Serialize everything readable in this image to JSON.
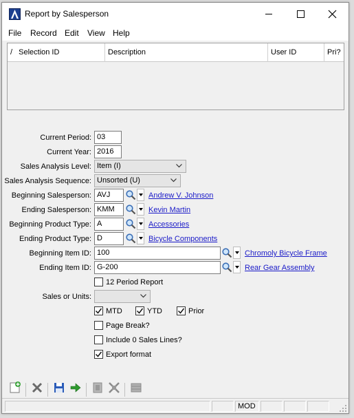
{
  "window": {
    "title": "Report by Salesperson"
  },
  "menu": [
    "File",
    "Record",
    "Edit",
    "View",
    "Help"
  ],
  "grid": {
    "columns": [
      "Selection ID",
      "Description",
      "User ID",
      "Pri?"
    ],
    "sort_indicator": "/"
  },
  "form": {
    "current_period": {
      "label": "Current Period:",
      "value": "03"
    },
    "current_year": {
      "label": "Current Year:",
      "value": "2016"
    },
    "sales_analysis_level": {
      "label": "Sales Analysis Level:",
      "value": "Item (I)"
    },
    "sales_analysis_sequence": {
      "label": "Sales Analysis Sequence:",
      "value": "Unsorted (U)"
    },
    "beginning_salesperson": {
      "label": "Beginning Salesperson:",
      "value": "AVJ",
      "link": "Andrew V. Johnson"
    },
    "ending_salesperson": {
      "label": "Ending Salesperson:",
      "value": "KMM",
      "link": "Kevin Martin"
    },
    "beginning_product_type": {
      "label": "Beginning Product Type:",
      "value": "A",
      "link": "Accessories"
    },
    "ending_product_type": {
      "label": "Ending Product Type:",
      "value": "D",
      "link": "Bicycle Components"
    },
    "beginning_item_id": {
      "label": "Beginning Item ID:",
      "value": "100",
      "link": "Chromoly Bicycle Frame"
    },
    "ending_item_id": {
      "label": "Ending Item ID:",
      "value": "G-200",
      "link": "Rear Gear Assembly"
    },
    "twelve_period": {
      "label": "12 Period Report",
      "checked": false
    },
    "sales_or_units": {
      "label": "Sales or Units:",
      "value": ""
    },
    "mtd": {
      "label": "MTD",
      "checked": true
    },
    "ytd": {
      "label": "YTD",
      "checked": true
    },
    "prior": {
      "label": "Prior",
      "checked": true
    },
    "page_break": {
      "label": "Page Break?",
      "checked": false
    },
    "include_zero": {
      "label": "Include 0 Sales Lines?",
      "checked": false
    },
    "export_format": {
      "label": "Export format",
      "checked": true
    }
  },
  "toolbar": [
    "new-record-icon",
    "delete-icon",
    "save-icon",
    "go-icon",
    "clear-icon",
    "shrink-icon",
    "list-icon"
  ],
  "statusbar": {
    "mode": "MOD"
  },
  "colors": {
    "link": "#1a1ac8",
    "logo": "#1c3f8f",
    "go_arrow": "#2e9a2e",
    "save": "#2a5bb8"
  }
}
